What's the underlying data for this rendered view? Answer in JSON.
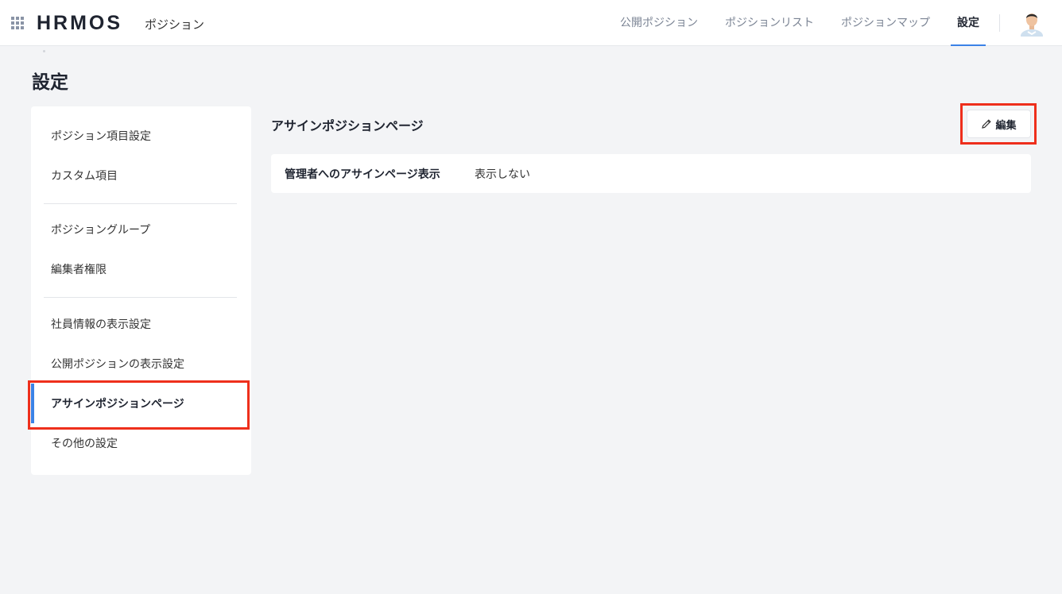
{
  "header": {
    "logo": "HRMOS",
    "product": "ポジション",
    "nav": [
      {
        "label": "公開ポジション"
      },
      {
        "label": "ポジションリスト"
      },
      {
        "label": "ポジションマップ"
      },
      {
        "label": "設定"
      }
    ],
    "active_nav": "設定",
    "accent_color": "#3b82e6"
  },
  "page": {
    "title": "設定"
  },
  "sidebar": {
    "items": [
      {
        "label": "ポジション項目設定"
      },
      {
        "label": "カスタム項目"
      },
      {
        "label": "ポジショングループ"
      },
      {
        "label": "編集者権限"
      },
      {
        "label": "社員情報の表示設定"
      },
      {
        "label": "公開ポジションの表示設定"
      },
      {
        "label": "アサインポジションページ"
      },
      {
        "label": "その他の設定"
      }
    ],
    "active_item": "アサインポジションページ"
  },
  "main": {
    "section_title": "アサインポジションページ",
    "edit_label": "編集",
    "row": {
      "label": "管理者へのアサインページ表示",
      "value": "表示しない"
    }
  },
  "highlight_color": "#ee2f1c"
}
